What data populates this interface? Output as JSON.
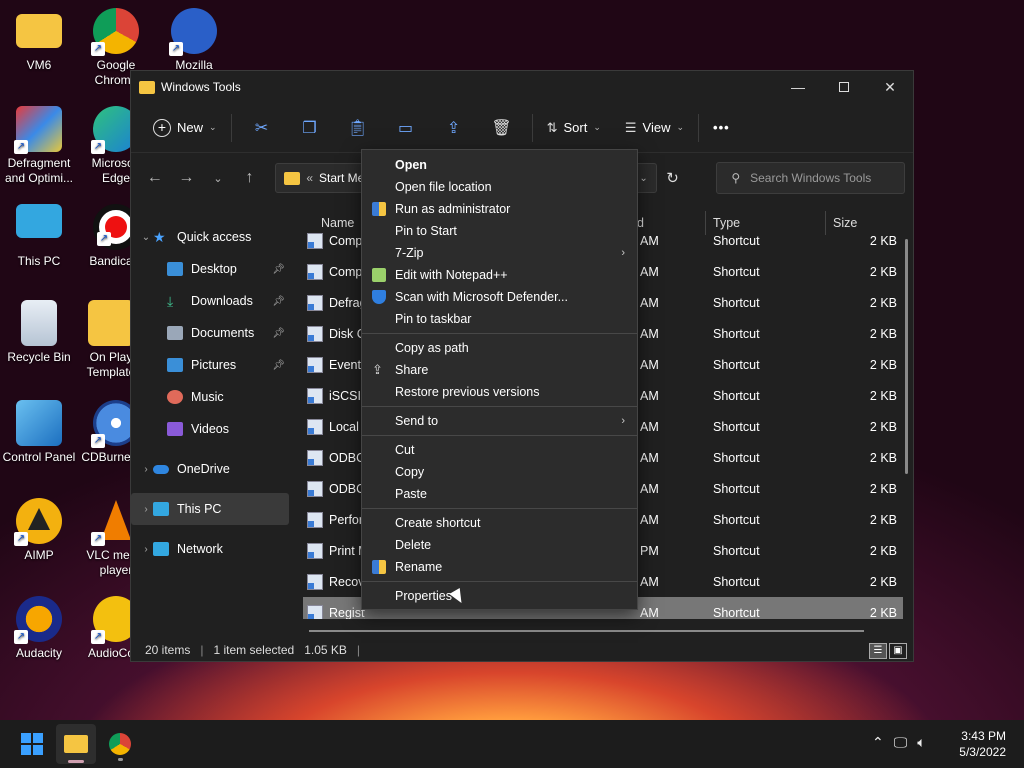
{
  "desktop": {
    "icons": [
      {
        "label": "VM6"
      },
      {
        "label": "Google Chrome"
      },
      {
        "label": "Mozilla"
      },
      {
        "label": "Defragment and Optimi..."
      },
      {
        "label": "Microsoft Edge"
      },
      {
        "label": "This PC"
      },
      {
        "label": "Bandicam"
      },
      {
        "label": "Recycle Bin"
      },
      {
        "label": "On Play Template"
      },
      {
        "label": "Control Panel"
      },
      {
        "label": "CDBurnerXP"
      },
      {
        "label": "AIMP"
      },
      {
        "label": "VLC media player"
      },
      {
        "label": "Audacity"
      },
      {
        "label": "AudioCo..."
      }
    ]
  },
  "window": {
    "title": "Windows Tools",
    "toolbar": {
      "new_label": "New",
      "sort_label": "Sort",
      "view_label": "View",
      "more_label": "•••"
    },
    "address": {
      "path": "Start Men",
      "prefix": "«"
    },
    "search": {
      "placeholder": "Search Windows Tools"
    },
    "sidebar": {
      "quick_access": "Quick access",
      "items": [
        {
          "label": "Desktop"
        },
        {
          "label": "Downloads"
        },
        {
          "label": "Documents"
        },
        {
          "label": "Pictures"
        },
        {
          "label": "Music"
        },
        {
          "label": "Videos"
        }
      ],
      "onedrive": "OneDrive",
      "thispc": "This PC",
      "network": "Network"
    },
    "columns": {
      "name": "Name",
      "date": "d",
      "type": "Type",
      "size": "Size"
    },
    "rows": [
      {
        "name": "Comp",
        "time": "AM",
        "type": "Shortcut",
        "size": "2 KB"
      },
      {
        "name": "Comp",
        "time": "AM",
        "type": "Shortcut",
        "size": "2 KB"
      },
      {
        "name": "Defrag",
        "time": "AM",
        "type": "Shortcut",
        "size": "2 KB"
      },
      {
        "name": "Disk C",
        "time": "AM",
        "type": "Shortcut",
        "size": "2 KB"
      },
      {
        "name": "Event",
        "time": "AM",
        "type": "Shortcut",
        "size": "2 KB"
      },
      {
        "name": "iSCSI I",
        "time": "AM",
        "type": "Shortcut",
        "size": "2 KB"
      },
      {
        "name": "Local",
        "time": "AM",
        "type": "Shortcut",
        "size": "2 KB"
      },
      {
        "name": "ODBC",
        "time": "AM",
        "type": "Shortcut",
        "size": "2 KB"
      },
      {
        "name": "ODBC",
        "time": "AM",
        "type": "Shortcut",
        "size": "2 KB"
      },
      {
        "name": "Perfor",
        "time": "AM",
        "type": "Shortcut",
        "size": "2 KB"
      },
      {
        "name": "Print M",
        "time": "PM",
        "type": "Shortcut",
        "size": "2 KB"
      },
      {
        "name": "Recov",
        "time": "AM",
        "type": "Shortcut",
        "size": "2 KB"
      },
      {
        "name": "Registy",
        "time": "AM",
        "type": "Shortcut",
        "size": "2 KB"
      }
    ],
    "status": {
      "items": "20 items",
      "selected": "1 item selected",
      "size": "1.05 KB"
    }
  },
  "context_menu": {
    "items": [
      {
        "label": "Open"
      },
      {
        "label": "Open file location"
      },
      {
        "label": "Run as administrator"
      },
      {
        "label": "Pin to Start"
      },
      {
        "label": "7-Zip"
      },
      {
        "label": "Edit with Notepad++"
      },
      {
        "label": "Scan with Microsoft Defender..."
      },
      {
        "label": "Pin to taskbar"
      },
      {
        "label": "Copy as path"
      },
      {
        "label": "Share"
      },
      {
        "label": "Restore previous versions"
      },
      {
        "label": "Send to"
      },
      {
        "label": "Cut"
      },
      {
        "label": "Copy"
      },
      {
        "label": "Paste"
      },
      {
        "label": "Create shortcut"
      },
      {
        "label": "Delete"
      },
      {
        "label": "Rename"
      },
      {
        "label": "Properties"
      }
    ]
  },
  "taskbar": {
    "time": "3:43 PM",
    "date": "5/3/2022"
  }
}
